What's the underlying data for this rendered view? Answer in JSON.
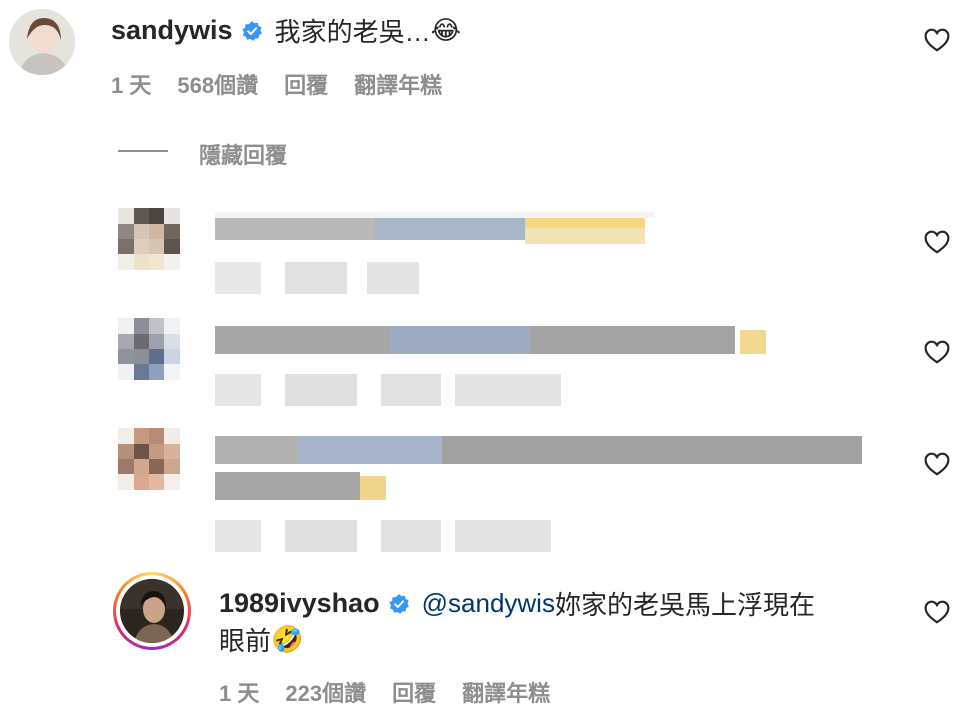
{
  "comments": [
    {
      "username": "sandywis",
      "text": "我家的老吳…",
      "emoji": "😂",
      "time": "1 天",
      "likes": "568個讚",
      "reply": "回覆",
      "translate": "翻譯年糕"
    },
    {
      "username": "1989ivyshao",
      "mention": "@sandywis",
      "text": " 妳家的老吳馬上浮現在",
      "text2": "眼前",
      "emoji": "🤣",
      "time": "1 天",
      "likes": "223個讚",
      "reply": "回覆",
      "translate": "翻譯年糕"
    }
  ],
  "hide_replies": "隱藏回覆",
  "icons": {
    "verified": "verified-badge-icon",
    "heart": "heart-outline-icon"
  },
  "colors": {
    "verified": "#3897f0",
    "mention": "#00376b",
    "meta": "#8e8e8e"
  }
}
